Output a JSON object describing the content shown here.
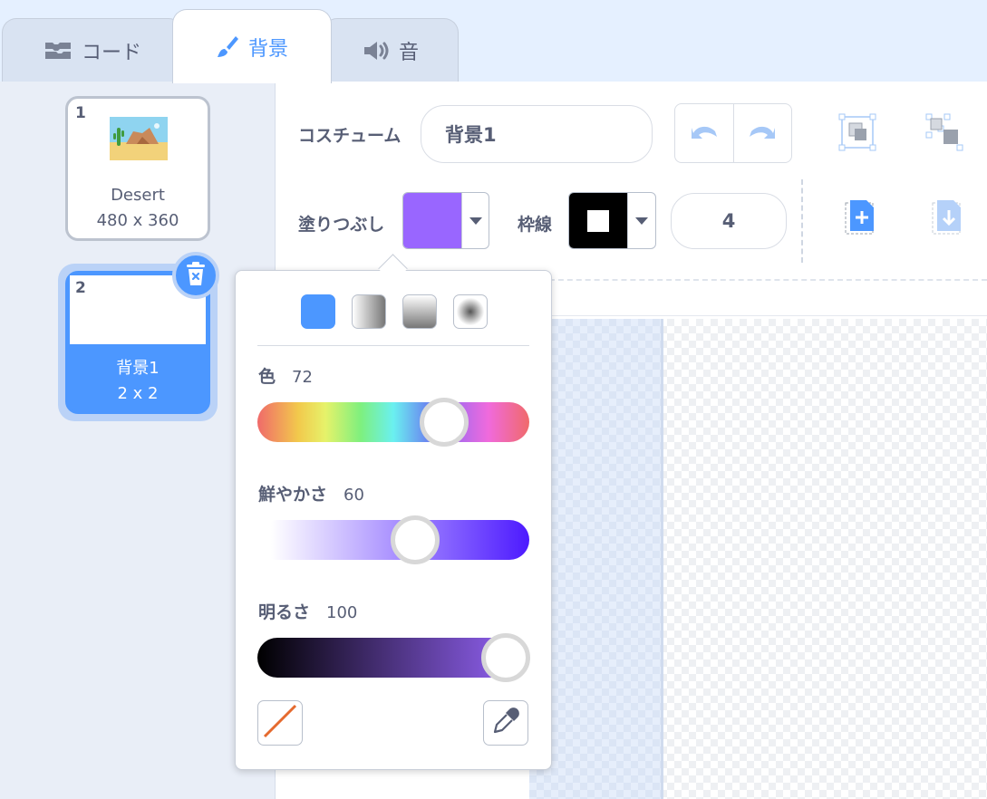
{
  "tabs": {
    "code": "コード",
    "backdrops": "背景",
    "sounds": "音",
    "active": "backdrops"
  },
  "backdrop_list": [
    {
      "index": "1",
      "name": "Desert",
      "size": "480 x 360",
      "selected": false
    },
    {
      "index": "2",
      "name": "背景1",
      "size": "2 x 2",
      "selected": true
    }
  ],
  "editor": {
    "costume_label": "コスチューム",
    "costume_name": "背景1",
    "fill_label": "塗りつぶし",
    "fill_color": "#9966ff",
    "outline_label": "枠線",
    "outline_color": "#000000",
    "outline_width": "4"
  },
  "color_picker": {
    "fill_modes": [
      "solid",
      "horizontal-gradient",
      "vertical-gradient",
      "radial-gradient"
    ],
    "active_fill_mode": "solid",
    "hue_label": "色",
    "hue_value": "72",
    "saturation_label": "鮮やかさ",
    "saturation_value": "60",
    "brightness_label": "明るさ",
    "brightness_value": "100"
  },
  "colors": {
    "accent": "#4c97ff",
    "text": "#575e75"
  }
}
